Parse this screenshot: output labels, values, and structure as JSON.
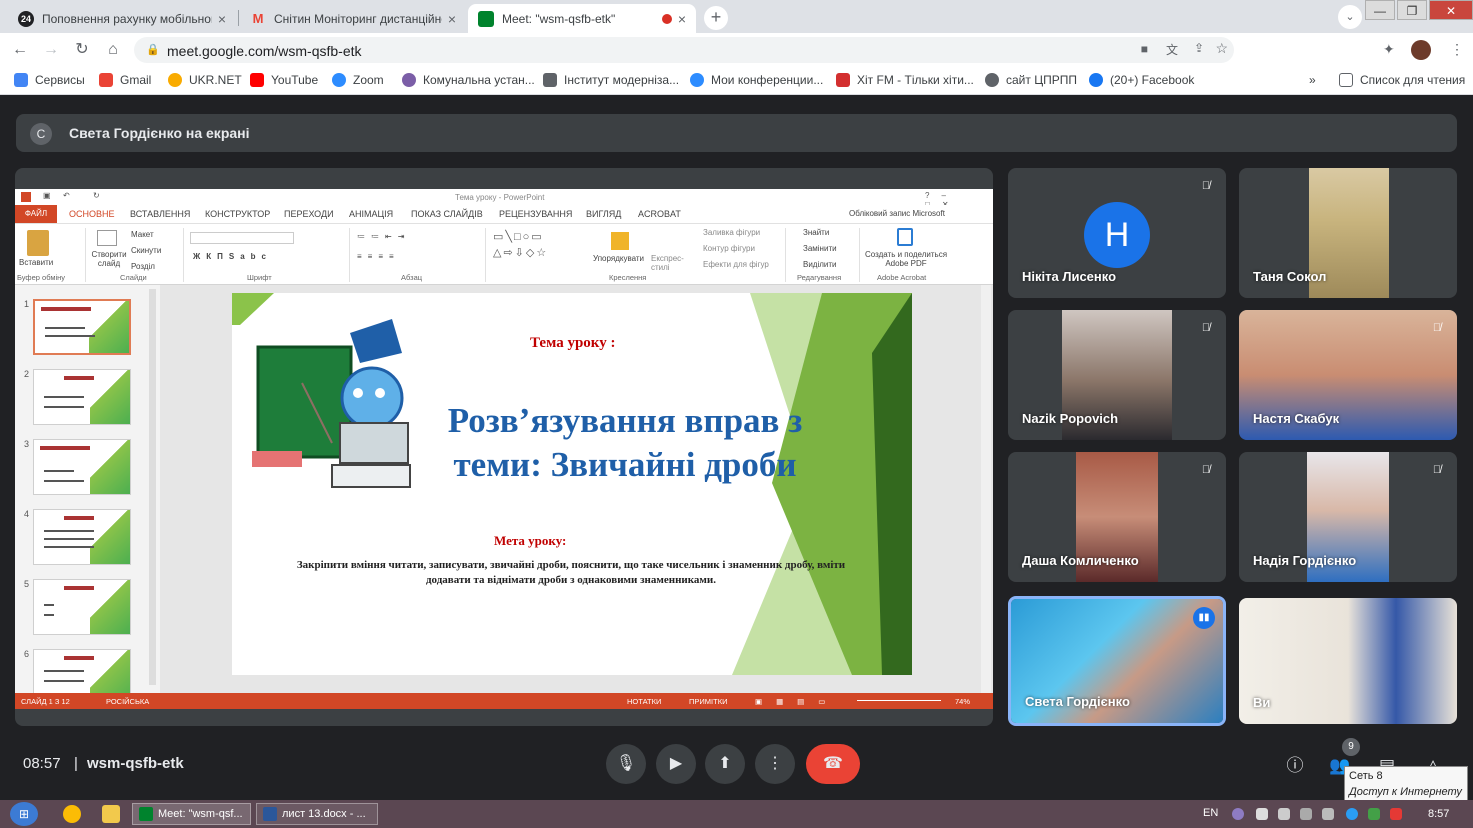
{
  "browser": {
    "tabs": [
      {
        "title": "Поповнення рахунку мобільного",
        "favicon_badge": "24",
        "favicon_color": "#202124",
        "close": "×"
      },
      {
        "title": "Снітин Моніторинг дистанційного",
        "favicon_badge": "M",
        "favicon_color": "#ea4335",
        "close": "×"
      },
      {
        "title": "Meet: \"wsm-qsfb-etk\"",
        "favicon_badge": "",
        "favicon_color": "#00832d",
        "close": "×",
        "recording": true
      }
    ],
    "new_tab": "+",
    "tab_menu": "⌄",
    "window_controls": {
      "minimize": "—",
      "maximize": "❐",
      "close": "✕"
    },
    "url": "meet.google.com/wsm-qsfb-etk",
    "bookmarks": [
      {
        "label": "Сервисы",
        "icon": "apps-icon",
        "color": "#4285f4"
      },
      {
        "label": "Gmail",
        "icon": "gmail-icon",
        "color": "#ea4335"
      },
      {
        "label": "UKR.NET",
        "icon": "ukrnet-icon",
        "color": "#f9ab00"
      },
      {
        "label": "YouTube",
        "icon": "youtube-icon",
        "color": "#ff0000"
      },
      {
        "label": "Zoom",
        "icon": "zoom-icon",
        "color": "#2d8cff"
      },
      {
        "label": "Комунальна устан...",
        "icon": "site-icon",
        "color": "#7b5ea7"
      },
      {
        "label": "Інститут модерніза...",
        "icon": "site-icon",
        "color": "#5f6368"
      },
      {
        "label": "Мои конференции...",
        "icon": "zoom-icon",
        "color": "#2d8cff"
      },
      {
        "label": "Хіт FM - Тільки хіти...",
        "icon": "hitfm-icon",
        "color": "#d32f2f"
      },
      {
        "label": "сайт ЦПРПП",
        "icon": "globe-icon",
        "color": "#5f6368"
      },
      {
        "label": "(20+) Facebook",
        "icon": "facebook-icon",
        "color": "#1877f2"
      }
    ],
    "bookmarks_more": "»",
    "reading_list": "Список для чтения"
  },
  "meet": {
    "presenter_initial": "С",
    "presenter_banner": "Света Гордієнко на екрані",
    "time": "08:57",
    "separator": "|",
    "meeting_code": "wsm-qsfb-etk",
    "people_count": "9",
    "participants": [
      {
        "name": "Нікіта Лисенко",
        "avatar": "Н",
        "muted": true
      },
      {
        "name": "Таня Сокол",
        "muted": false
      },
      {
        "name": "Nazik Popovich",
        "muted": true
      },
      {
        "name": "Настя Скабук",
        "muted": true
      },
      {
        "name": "Даша Комличенко",
        "muted": true
      },
      {
        "name": "Надія Гордієнко",
        "muted": true
      },
      {
        "name": "Света Гордієнко",
        "muted": false,
        "speaking": true
      },
      {
        "name": "Ви",
        "muted": false
      }
    ],
    "network_tooltip": {
      "line1": "Сеть  8",
      "line2": "Доступ к Интернету"
    }
  },
  "powerpoint": {
    "window_title": "Тема уроку - PowerPoint",
    "tabs": [
      "ФАЙЛ",
      "ОСНОВНЕ",
      "ВСТАВЛЕННЯ",
      "КОНСТРУКТОР",
      "ПЕРЕХОДИ",
      "АНІМАЦІЯ",
      "ПОКАЗ СЛАЙДІВ",
      "РЕЦЕНЗУВАННЯ",
      "ВИГЛЯД",
      "ACROBAT"
    ],
    "account": "Обліковий запис Microsoft",
    "ribbon": {
      "paste": "Вставити",
      "new_slide": "Створити слайд",
      "layout": "Макет",
      "reset": "Скинути",
      "section": "Розділ",
      "arrange": "Упорядкувати",
      "quick_styles": "Експрес-стилі",
      "shape_fill": "Заливка фігури",
      "shape_outline": "Контур фігури",
      "shape_effects": "Ефекти для фігур",
      "find": "Знайти",
      "replace": "Замінити",
      "select": "Виділити",
      "create_pdf": "Создать и поделиться Adobe PDF",
      "groups": [
        "Буфер обміну",
        "Слайди",
        "Шрифт",
        "Абзац",
        "Креслення",
        "Редагування",
        "Adobe Acrobat"
      ]
    },
    "thumbnails": [
      "1",
      "2",
      "3",
      "4",
      "5",
      "6"
    ],
    "slide": {
      "topic_label": "Тема уроку :",
      "heading": "Розв’язування вправ з теми: Звичайні дроби",
      "goal_label": "Мета уроку:",
      "goal_text": "Закріпити вміння читати, записувати, звичайні дроби, пояснити, що таке чисельник і знаменник дробу, вміти додавати та віднімати дроби з однаковими знаменниками."
    },
    "status": {
      "slide_info": "СЛАЙД 1 З 12",
      "language": "РОСІЙСЬКА",
      "notes": "НОТАТКИ",
      "comments": "ПРИМІТКИ",
      "zoom": "74%"
    }
  },
  "taskbar": {
    "apps": [
      {
        "label": "Meet: \"wsm-qsf...",
        "color": "#00832d"
      },
      {
        "label": "лист 13.docx - ...",
        "color": "#2b579a"
      }
    ],
    "lang": "EN",
    "clock": "8:57"
  }
}
